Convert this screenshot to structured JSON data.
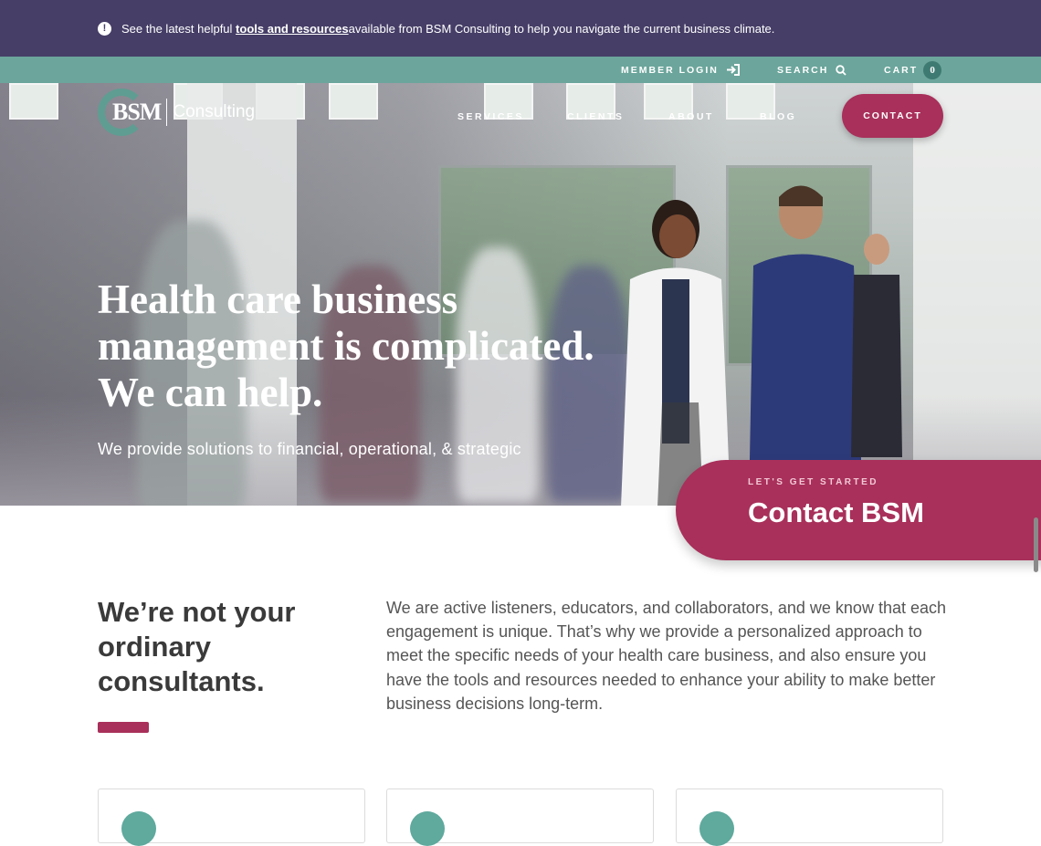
{
  "announcement": {
    "prefix": "See the latest helpful ",
    "link": "tools and resources",
    "suffix": " available from BSM Consulting to help you navigate the current business climate."
  },
  "utility_nav": {
    "member_login": "Member Login",
    "search": "Search",
    "cart": "Cart",
    "cart_count": "0"
  },
  "brand": {
    "mark": "BSM",
    "name": "Consulting"
  },
  "main_nav": {
    "items": [
      "Services",
      "Clients",
      "About",
      "Blog"
    ],
    "contact": "Contact"
  },
  "hero": {
    "headline": "Health care business management is complicated. We can help.",
    "subline": "We provide solutions to financial, operational, & strategic"
  },
  "cta": {
    "eyebrow": "Let's get started",
    "title": "Contact BSM"
  },
  "intro": {
    "heading": "We’re not your ordinary consultants.",
    "body": "We are active listeners, educators, and collaborators, and we know that each engagement is unique. That’s why we provide a personalized approach to meet the specific needs of your health care business, and also ensure you have the tools and resources needed to enhance your ability to make better business decisions long-term."
  },
  "colors": {
    "announce_bg": "#463e67",
    "utility_bg": "#6ba59b",
    "accent": "#a8305a",
    "teal": "#5fa99d"
  }
}
